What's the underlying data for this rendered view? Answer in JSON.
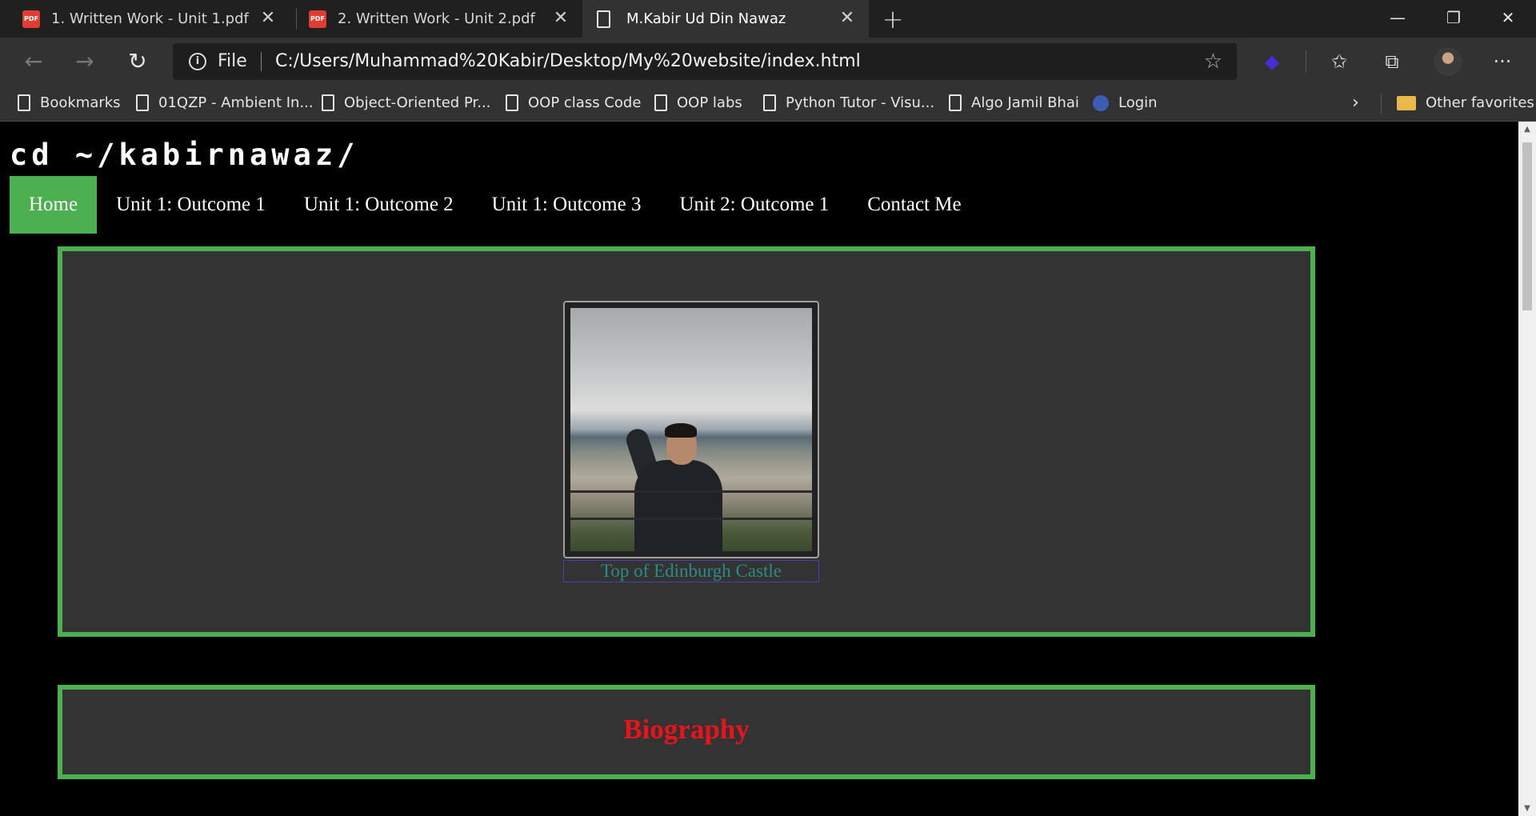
{
  "browser": {
    "tabs": [
      {
        "title": "1. Written Work - Unit 1.pdf",
        "icon": "pdf-icon"
      },
      {
        "title": "2. Written Work - Unit 2.pdf",
        "icon": "pdf-icon"
      },
      {
        "title": "M.Kabir Ud Din Nawaz",
        "icon": "page-icon",
        "active": true
      }
    ],
    "address": {
      "scheme_label": "File",
      "url": "C:/Users/Muhammad%20Kabir/Desktop/My%20website/index.html"
    },
    "bookmarks": [
      {
        "label": "Bookmarks",
        "icon": "page-icon"
      },
      {
        "label": "01QZP - Ambient In...",
        "icon": "page-icon"
      },
      {
        "label": "Object-Oriented Pr...",
        "icon": "page-icon"
      },
      {
        "label": "OOP class Code",
        "icon": "page-icon"
      },
      {
        "label": "OOP labs",
        "icon": "page-icon"
      },
      {
        "label": "Python Tutor - Visu...",
        "icon": "page-icon"
      },
      {
        "label": "Algo Jamil Bhai",
        "icon": "page-icon"
      },
      {
        "label": "Login",
        "icon": "globe-icon"
      }
    ],
    "other_favorites": "Other favorites"
  },
  "site": {
    "title": "cd ~/kabirnawaz/",
    "nav": [
      {
        "label": "Home",
        "active": true
      },
      {
        "label": "Unit 1: Outcome 1"
      },
      {
        "label": "Unit 1: Outcome 2"
      },
      {
        "label": "Unit 1: Outcome 3"
      },
      {
        "label": "Unit 2: Outcome 1"
      },
      {
        "label": "Contact Me"
      }
    ],
    "photo_caption": "Top of Edinburgh Castle",
    "bio_heading": "Biography"
  },
  "colors": {
    "accent_green": "#4caf50",
    "panel_bg": "#333333",
    "caption_teal": "#2c8a88",
    "heading_red": "#e8141c"
  }
}
